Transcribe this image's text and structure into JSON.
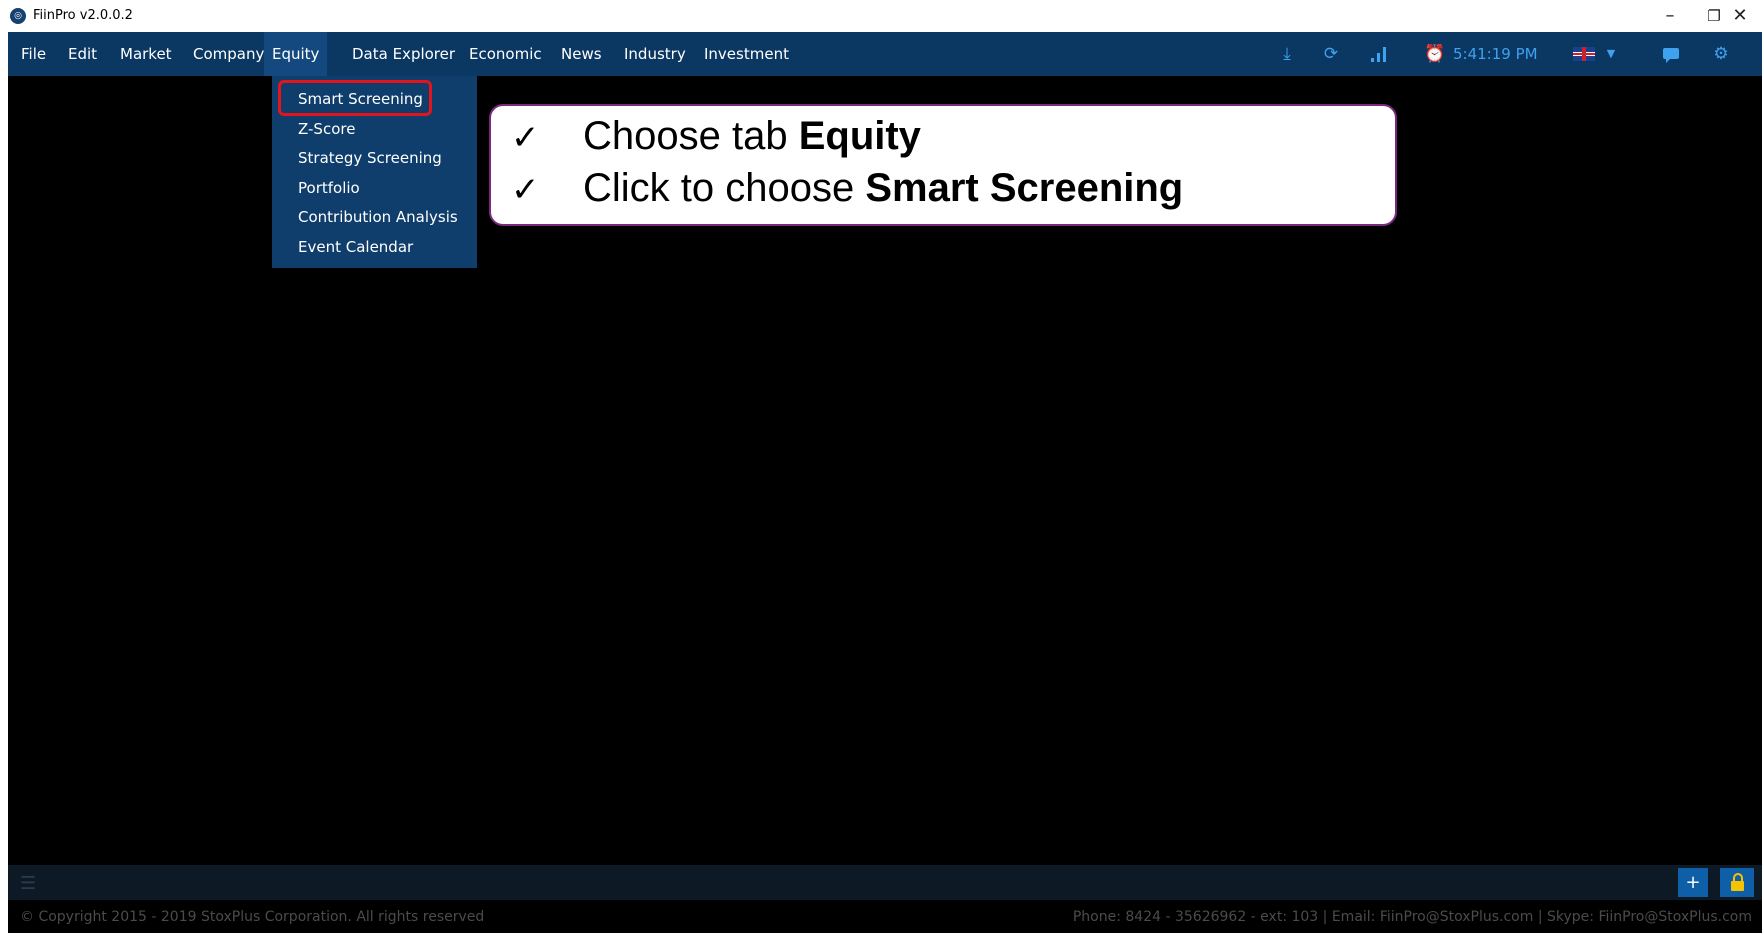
{
  "window": {
    "title": "FiinPro v2.0.0.2",
    "minimize_glyph": "–",
    "restore_glyph": "❐",
    "close_glyph": "✕"
  },
  "menu": {
    "items": [
      "File",
      "Edit",
      "Market",
      "Company",
      "Equity",
      "Data Explorer",
      "Economic",
      "News",
      "Industry",
      "Investment"
    ],
    "active": "Equity"
  },
  "toolbar": {
    "clock": "5:41:19 PM",
    "icons": [
      "download-icon",
      "refresh-icon",
      "signal-icon",
      "alarm-clock-icon",
      "uk-flag-icon",
      "chevron-down-icon",
      "chat-icon",
      "gear-icon"
    ],
    "accent_color": "#3fa2ee"
  },
  "equity_menu": {
    "items": [
      "Smart Screening",
      "Z-Score",
      "Strategy Screening",
      "Portfolio",
      "Contribution Analysis",
      "Event Calendar"
    ],
    "highlighted": "Smart Screening",
    "highlight_color": "#e3141c"
  },
  "instructions": {
    "line1_prefix": "Choose tab ",
    "line1_bold": "Equity",
    "line2_prefix": "Click to choose ",
    "line2_bold": "Smart Screening",
    "check_glyph": "✓"
  },
  "bottom_bar": {
    "add_label": "+",
    "icons": [
      "menu-icon",
      "lock-icon"
    ]
  },
  "footer": {
    "copyright": "© Copyright 2015 - 2019 StoxPlus Corporation. All rights reserved",
    "contact": "Phone: 8424 - 35626962 - ext: 103 | Email: FiinPro@StoxPlus.com | Skype: FiinPro@StoxPlus.com"
  },
  "colors": {
    "menubar": "#0b3763",
    "dropdown": "#0f3e6c",
    "workspace": "#000000"
  }
}
